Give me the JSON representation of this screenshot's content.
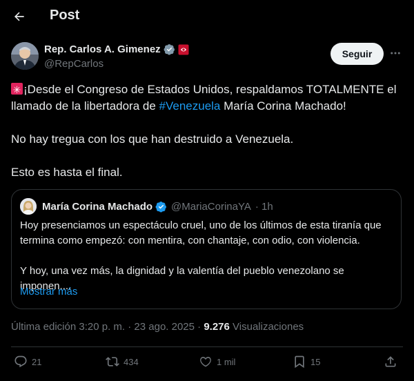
{
  "header": {
    "title": "Post"
  },
  "author": {
    "name": "Rep. Carlos A. Gimenez",
    "handle": "@RepCarlos",
    "follow_label": "Seguir"
  },
  "tweet": {
    "line1_pre": "¡Desde el Congreso de Estados Unidos, respaldamos TOTALMENTE el llamado de la libertadora de ",
    "hashtag": "#Venezuela",
    "line1_post": " María Corina Machado!",
    "para2": "No hay tregua con los que han destruido a Venezuela.",
    "para3": "Esto es hasta el final."
  },
  "quote": {
    "name": "María Corina Machado",
    "handle": "@MariaCorinaYA",
    "time": "· 1h",
    "para1": "Hoy presenciamos un espectáculo cruel, uno de los últimos de esta tiranía que termina como empezó: con mentira, con chantaje, con odio, con violencia.",
    "para2": "Y hoy, una vez más, la dignidad y la valentía del pueblo venezolano se imponen....",
    "show_more": "Mostrar más"
  },
  "meta": {
    "edited": "Última edición 3:20 p. m. · 23 ago. 2025 · ",
    "views_count": "9.276",
    "views_label": " Visualizaciones"
  },
  "actions": {
    "replies": "21",
    "reposts": "434",
    "likes": "1 mil",
    "bookmarks": "15"
  },
  "colors": {
    "background": "#000000",
    "text": "#e7e9ea",
    "secondary": "#71767b",
    "link": "#1d9bf0",
    "border": "#2f3336",
    "verified": "#1d9bf0"
  }
}
